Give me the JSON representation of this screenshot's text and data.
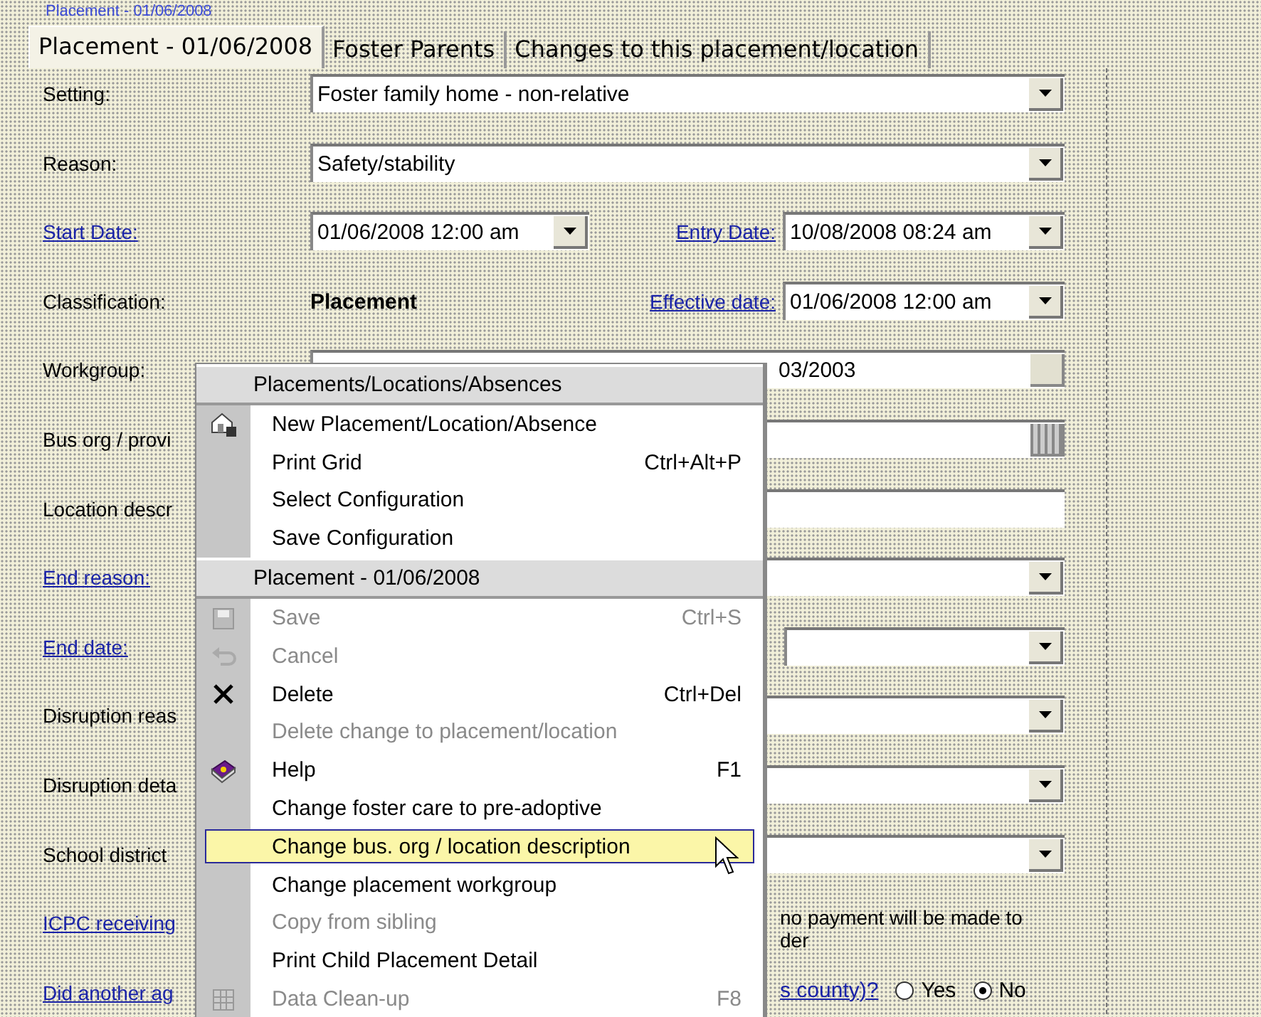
{
  "top_caption": "Placement - 01/06/2008",
  "tabs": [
    {
      "label": "Placement - 01/06/2008",
      "selected": true
    },
    {
      "label": "Foster Parents",
      "selected": false
    },
    {
      "label": "Changes to this placement/location",
      "selected": false
    }
  ],
  "fields": [
    {
      "label": "Setting:",
      "link": false,
      "kind": "dropdown",
      "value": "Foster family home - non-relative"
    },
    {
      "label": "Reason:",
      "link": false,
      "kind": "dropdown",
      "value": "Safety/stability"
    },
    {
      "label": "Start Date:",
      "link": true,
      "kind": "date",
      "value": "01/06/2008 12:00 am",
      "second": {
        "label": "Entry Date:",
        "link": true,
        "value": "10/08/2008 08:24 am"
      }
    },
    {
      "label": "Classification:",
      "link": false,
      "kind": "static",
      "value": "Placement",
      "second": {
        "label": "Effective date:",
        "link": true,
        "value": "01/06/2008 12:00 am"
      }
    },
    {
      "label": "Workgroup:",
      "link": false,
      "kind": "lookup",
      "value": "03/2003"
    },
    {
      "label": "Bus org / provi",
      "link": false,
      "kind": "grid-lookup"
    },
    {
      "label": "Location descr",
      "link": false,
      "kind": "text"
    },
    {
      "label": "End reason:",
      "link": true,
      "kind": "dropdown"
    },
    {
      "label": "End date:",
      "link": true,
      "kind": "right-dropdown"
    },
    {
      "label": "Disruption reas",
      "link": false,
      "kind": "dropdown"
    },
    {
      "label": "Disruption deta",
      "link": false,
      "kind": "dropdown"
    },
    {
      "label": "School district",
      "link": false,
      "kind": "dropdown"
    },
    {
      "label": "ICPC receiving",
      "link": true,
      "kind": "note",
      "lines": [
        "no payment will be made to",
        "der"
      ]
    },
    {
      "label": "Did another ag",
      "link": true,
      "kind": "radio",
      "text": "s county)?",
      "options": [
        {
          "label": "Yes",
          "selected": false
        },
        {
          "label": "No",
          "selected": true
        }
      ]
    }
  ],
  "menu": [
    {
      "title": "Placements/Locations/Absences",
      "items": [
        {
          "label": "New Placement/Location/Absence",
          "kind": "house",
          "disabled": false,
          "selected": false
        },
        {
          "label": "Print Grid",
          "shortcut": "Ctrl+Alt+P",
          "disabled": false,
          "selected": false
        },
        {
          "label": "Select Configuration",
          "disabled": false,
          "selected": false
        },
        {
          "label": "Save Configuration",
          "disabled": false,
          "selected": false
        }
      ]
    },
    {
      "title": "Placement - 01/06/2008",
      "items": [
        {
          "label": "Save",
          "shortcut": "Ctrl+S",
          "kind": "save",
          "disabled": true,
          "selected": false
        },
        {
          "label": "Cancel",
          "kind": "cancel",
          "disabled": true,
          "selected": false
        },
        {
          "label": "Delete",
          "shortcut": "Ctrl+Del",
          "kind": "delete",
          "disabled": false,
          "selected": false
        },
        {
          "label": "Delete change to placement/location",
          "disabled": true,
          "selected": false
        },
        {
          "label": "Help",
          "shortcut": "F1",
          "kind": "help",
          "disabled": false,
          "selected": false
        },
        {
          "label": "Change foster care to pre-adoptive",
          "disabled": false,
          "selected": false
        },
        {
          "label": "Change bus. org / location description",
          "disabled": false,
          "selected": true
        },
        {
          "label": "Change placement workgroup",
          "disabled": false,
          "selected": false
        },
        {
          "label": "Copy from sibling",
          "disabled": true,
          "selected": false
        },
        {
          "label": "Print Child Placement Detail",
          "disabled": false,
          "selected": false
        },
        {
          "label": "Data Clean-up",
          "shortcut": "F8",
          "kind": "grid",
          "disabled": true,
          "selected": false
        }
      ]
    }
  ]
}
